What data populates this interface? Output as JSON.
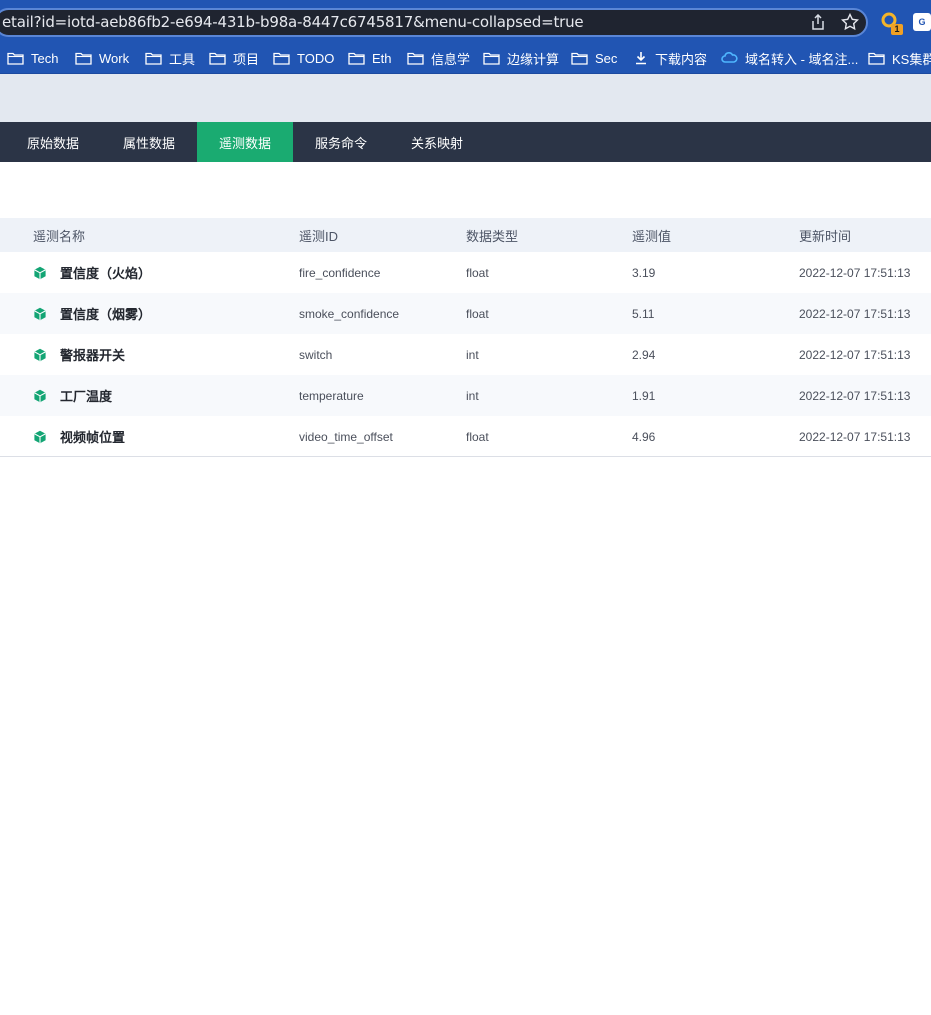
{
  "browser": {
    "url": "etail?id=iotd-aeb86fb2-e694-431b-b98a-8447c6745817&menu-collapsed=true",
    "share_icon": "share-icon",
    "star_icon": "star-icon",
    "extension_badge": "1",
    "translate_icon_text": "G"
  },
  "bookmarks": [
    {
      "label": "Tech",
      "icon": "folder-icon"
    },
    {
      "label": "Work",
      "icon": "folder-icon"
    },
    {
      "label": "工具",
      "icon": "folder-icon"
    },
    {
      "label": "项目",
      "icon": "folder-icon"
    },
    {
      "label": "TODO",
      "icon": "folder-icon"
    },
    {
      "label": "Eth",
      "icon": "folder-icon"
    },
    {
      "label": "信息学",
      "icon": "folder-icon"
    },
    {
      "label": "边缘计算",
      "icon": "folder-icon"
    },
    {
      "label": "Sec",
      "icon": "folder-icon"
    },
    {
      "label": "下载内容",
      "icon": "download-icon"
    },
    {
      "label": "域名转入 - 域名注...",
      "icon": "cloud-icon"
    },
    {
      "label": "KS集群",
      "icon": "folder-icon"
    }
  ],
  "tabs": [
    {
      "label": "原始数据",
      "active": false
    },
    {
      "label": "属性数据",
      "active": false
    },
    {
      "label": "遥测数据",
      "active": true
    },
    {
      "label": "服务命令",
      "active": false
    },
    {
      "label": "关系映射",
      "active": false
    }
  ],
  "table": {
    "columns": [
      "遥测名称",
      "遥测ID",
      "数据类型",
      "遥测值",
      "更新时间"
    ],
    "rows": [
      {
        "name": "置信度（火焰）",
        "id": "fire_confidence",
        "type": "float",
        "value": "3.19",
        "time": "2022-12-07 17:51:13"
      },
      {
        "name": "置信度（烟雾）",
        "id": "smoke_confidence",
        "type": "float",
        "value": "5.11",
        "time": "2022-12-07 17:51:13"
      },
      {
        "name": "警报器开关",
        "id": "switch",
        "type": "int",
        "value": "2.94",
        "time": "2022-12-07 17:51:13"
      },
      {
        "name": "工厂温度",
        "id": "temperature",
        "type": "int",
        "value": "1.91",
        "time": "2022-12-07 17:51:13"
      },
      {
        "name": "视频帧位置",
        "id": "video_time_offset",
        "type": "float",
        "value": "4.96",
        "time": "2022-12-07 17:51:13"
      }
    ]
  },
  "colors": {
    "chrome_blue": "#2155b3",
    "tab_bar": "#2b3446",
    "tab_active": "#1aab71",
    "cube_icon": "#13a574"
  }
}
